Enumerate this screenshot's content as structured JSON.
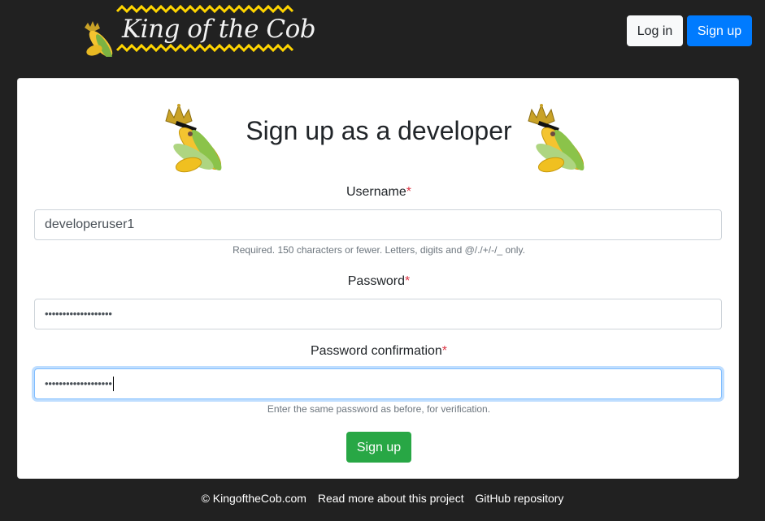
{
  "header": {
    "logo_text": "King of the Cob",
    "login_label": "Log in",
    "signup_label": "Sign up"
  },
  "form": {
    "title": "Sign up as a developer",
    "username": {
      "label": "Username",
      "required_mark": "*",
      "value": "developeruser1",
      "help": "Required. 150 characters or fewer. Letters, digits and @/./+/-/_ only."
    },
    "password": {
      "label": "Password",
      "required_mark": "*",
      "masked_value": "•••••••••••••••••••"
    },
    "password_confirmation": {
      "label": "Password confirmation",
      "required_mark": "*",
      "masked_value": "•••••••••••••••••••",
      "help": "Enter the same password as before, for verification."
    },
    "submit_label": "Sign up"
  },
  "footer": {
    "copyright": "© KingoftheCob.com",
    "about_link": "Read more about this project",
    "github_link": "GitHub repository"
  },
  "colors": {
    "background": "#212121",
    "primary": "#007bff",
    "success": "#28a745",
    "light": "#f8f9fa",
    "logo_accent": "#ffd500"
  }
}
